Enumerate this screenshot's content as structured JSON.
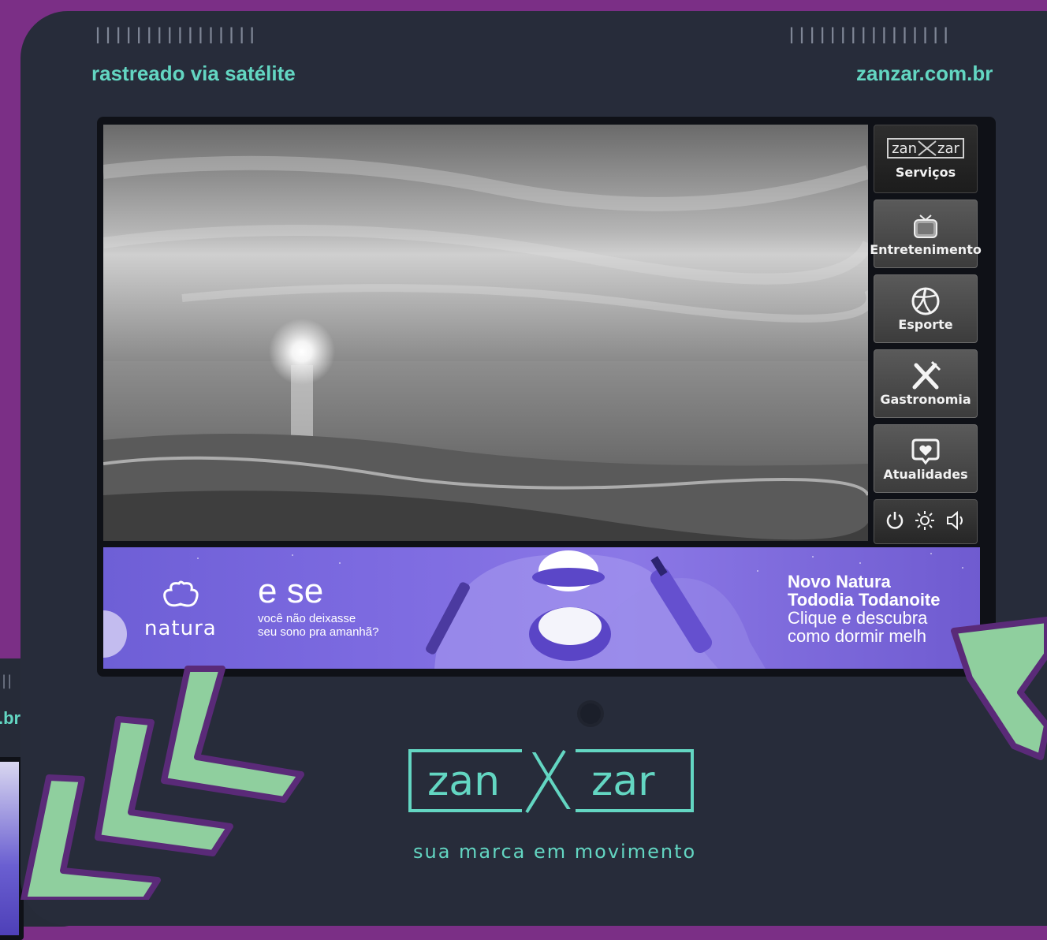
{
  "device": {
    "left_tagline": "rastreado via satélite",
    "right_tagline": "zanzar.com.br",
    "speaker_grille": "||||||||||||||||",
    "brand_tagline": "sua marca em movimento"
  },
  "back_device": {
    "dots": "||",
    "url": ".br"
  },
  "menu": {
    "logo_left": "zan",
    "logo_right": "zar",
    "items": [
      {
        "label": "Serviços",
        "icon": "zanzar-logo-icon"
      },
      {
        "label": "Entretenimento",
        "icon": "tv-icon"
      },
      {
        "label": "Esporte",
        "icon": "volleyball-icon"
      },
      {
        "label": "Gastronomia",
        "icon": "fork-knife-icon"
      },
      {
        "label": "Atualidades",
        "icon": "heart-bubble-icon"
      }
    ],
    "controls": [
      "power-icon",
      "brightness-icon",
      "volume-icon"
    ]
  },
  "banner": {
    "brand": "natura",
    "headline": "e se",
    "sub1": "você não deixasse",
    "sub2": "seu sono pra amanhã?",
    "promo_title1": "Novo Natura",
    "promo_title2": "Tododia Todanoite",
    "promo_line1": "Clique e descubra",
    "promo_line2": "como dormir melh"
  },
  "brand": {
    "left": "zan",
    "right": "zar"
  },
  "colors": {
    "background": "#7b2f86",
    "device": "#272c3a",
    "accent": "#63d6c2",
    "arrow": "#8fcf9e"
  }
}
